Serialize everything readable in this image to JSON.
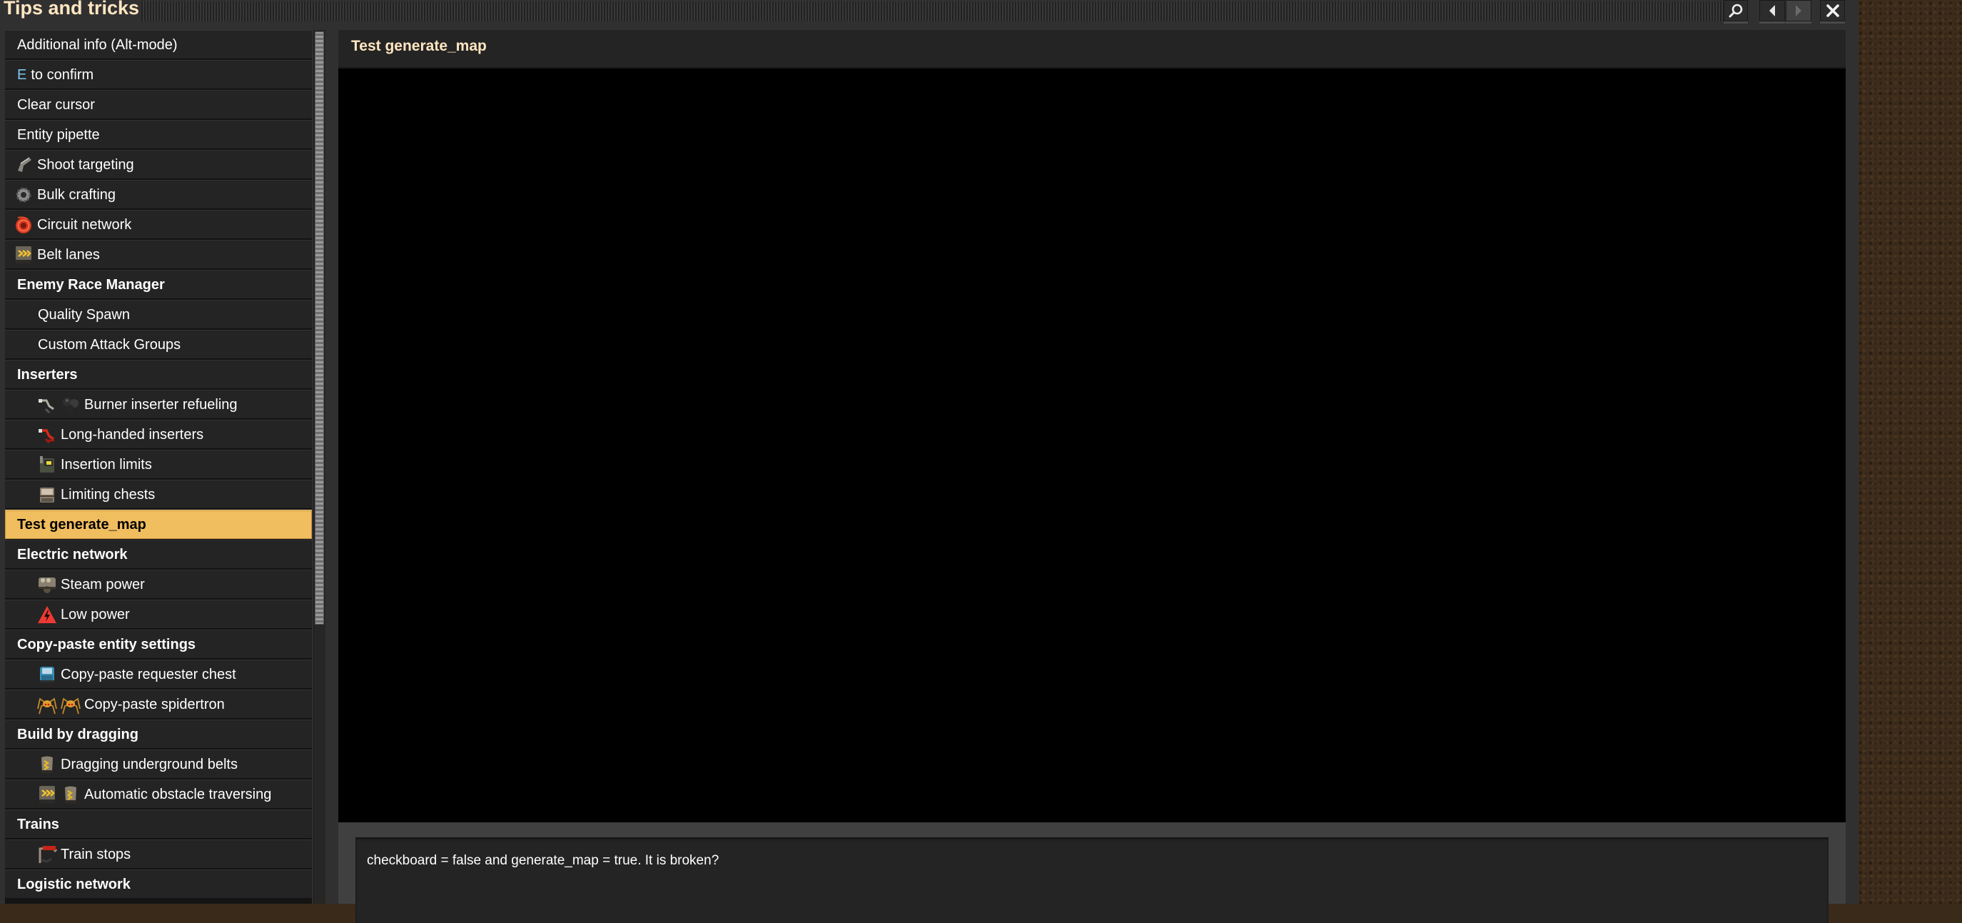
{
  "window": {
    "title": "Tips and tricks",
    "buttons": [
      {
        "name": "search",
        "icon": "search-icon",
        "enabled": true
      },
      {
        "name": "previous",
        "icon": "arrow-left-icon",
        "enabled": true
      },
      {
        "name": "next",
        "icon": "arrow-right-icon",
        "enabled": false
      },
      {
        "name": "close",
        "icon": "close-icon",
        "enabled": true
      }
    ]
  },
  "list": {
    "selected": "Test generate_map",
    "items": [
      {
        "label": "Additional info (Alt-mode)",
        "type": "top",
        "icons": []
      },
      {
        "label": "to confirm",
        "key": "E",
        "type": "top",
        "icons": []
      },
      {
        "label": "Clear cursor",
        "type": "top",
        "icons": []
      },
      {
        "label": "Entity pipette",
        "type": "top",
        "icons": []
      },
      {
        "label": "Shoot targeting",
        "type": "top",
        "icons": [
          "pistol-icon"
        ]
      },
      {
        "label": "Bulk crafting",
        "type": "top",
        "icons": [
          "gear-icon"
        ]
      },
      {
        "label": "Circuit network",
        "type": "top",
        "icons": [
          "red-wire-icon"
        ]
      },
      {
        "label": "Belt lanes",
        "type": "top",
        "icons": [
          "transport-belt-icon"
        ]
      },
      {
        "label": "Enemy Race Manager",
        "type": "category",
        "icons": []
      },
      {
        "label": "Quality Spawn",
        "type": "child",
        "icons": []
      },
      {
        "label": "Custom Attack Groups",
        "type": "child",
        "icons": []
      },
      {
        "label": "Inserters",
        "type": "category",
        "icons": []
      },
      {
        "label": "Burner inserter refueling",
        "type": "child",
        "icons": [
          "burner-inserter-icon",
          "coal-icon"
        ]
      },
      {
        "label": "Long-handed inserters",
        "type": "child",
        "icons": [
          "long-handed-inserter-icon"
        ]
      },
      {
        "label": "Insertion limits",
        "type": "child",
        "icons": [
          "assembling-machine-icon"
        ]
      },
      {
        "label": "Limiting chests",
        "type": "child",
        "icons": [
          "iron-chest-icon"
        ]
      },
      {
        "label": "Test generate_map",
        "type": "category",
        "icons": [],
        "selected": true
      },
      {
        "label": "Electric network",
        "type": "category",
        "icons": []
      },
      {
        "label": "Steam power",
        "type": "child",
        "icons": [
          "steam-engine-icon"
        ]
      },
      {
        "label": "Low power",
        "type": "child",
        "icons": [
          "warning-electric-icon"
        ]
      },
      {
        "label": "Copy-paste entity settings",
        "type": "category",
        "icons": []
      },
      {
        "label": "Copy-paste requester chest",
        "type": "child",
        "icons": [
          "requester-chest-icon"
        ]
      },
      {
        "label": "Copy-paste spidertron",
        "type": "child",
        "icons": [
          "spidertron-icon",
          "spidertron-icon"
        ]
      },
      {
        "label": "Build by dragging",
        "type": "category",
        "icons": []
      },
      {
        "label": "Dragging underground belts",
        "type": "child",
        "icons": [
          "underground-belt-icon"
        ]
      },
      {
        "label": "Automatic obstacle traversing",
        "type": "child",
        "icons": [
          "transport-belt-icon",
          "underground-belt-icon"
        ]
      },
      {
        "label": "Trains",
        "type": "category",
        "icons": []
      },
      {
        "label": "Train stops",
        "type": "child",
        "icons": [
          "train-stop-icon"
        ]
      },
      {
        "label": "Logistic network",
        "type": "category",
        "icons": []
      }
    ]
  },
  "content": {
    "title": "Test generate_map",
    "description": "checkboard = false and generate_map = true. It is broken?"
  },
  "colors": {
    "title_text": "#ffe6c0",
    "selected_row": "#f0bd5f",
    "key_highlight": "#7ec8f0",
    "row_bg": "#242424"
  }
}
